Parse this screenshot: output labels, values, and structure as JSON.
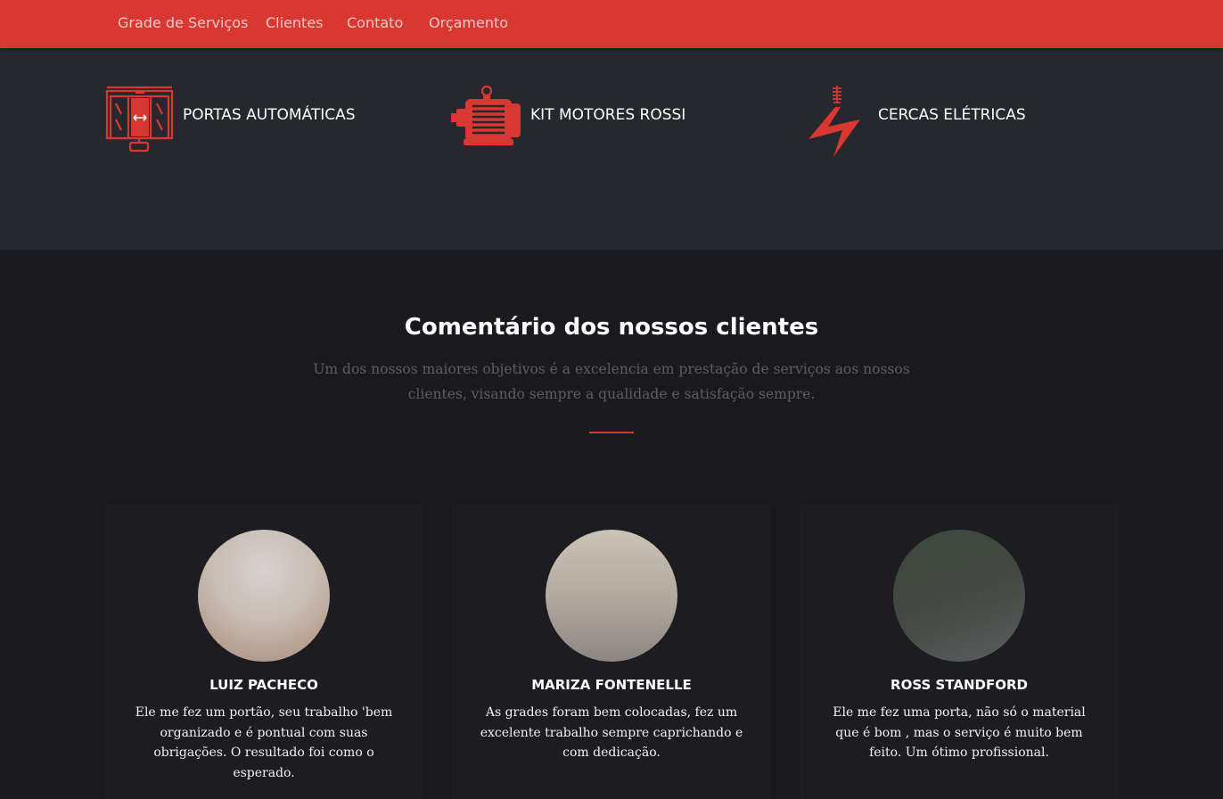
{
  "nav": {
    "items": [
      {
        "label": "Grade de Serviços"
      },
      {
        "label": "Clientes"
      },
      {
        "label": "Contato"
      },
      {
        "label": "Orçamento"
      }
    ]
  },
  "services": [
    {
      "label": "PORTAS AUTOMÁTICAS",
      "icon": "automatic-door-icon"
    },
    {
      "label": "KIT MOTORES ROSSI",
      "icon": "electric-motor-icon"
    },
    {
      "label": "CERCAS ELÉTRICAS",
      "icon": "lightning-bolt-icon"
    }
  ],
  "testimonials": {
    "title": "Comentário dos nossos clientes",
    "subtitle": "Um dos nossos maiores objetivos é a excelencia em prestação de serviços aos nossos clientes, visando sempre a qualidade e satisfação sempre.",
    "cards": [
      {
        "name": "LUIZ PACHECO",
        "text": "Ele me fez um portão, seu trabalho 'bem organizado e é pontual com suas obrigações. O resultado foi como o esperado."
      },
      {
        "name": "MARIZA FONTENELLE",
        "text": "As grades foram bem colocadas, fez um excelente trabalho sempre caprichando e com dedicação."
      },
      {
        "name": "ROSS STANDFORD",
        "text": "Ele me fez uma porta, não só o material que é bom , mas o serviço é muito bem feito. Um ótimo profissional."
      }
    ]
  },
  "colors": {
    "accent": "#d93832",
    "nav_text": "#f4c9c6",
    "services_bg": "#27282d",
    "page_bg": "#1a1a1e",
    "card_bg": "#1d1d21"
  }
}
